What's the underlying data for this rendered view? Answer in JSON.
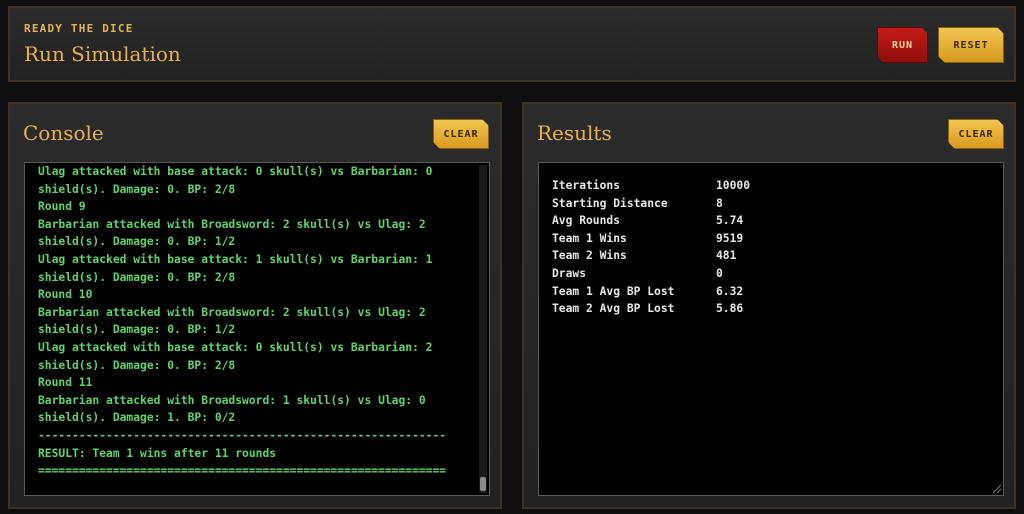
{
  "header": {
    "eyebrow": "READY THE DICE",
    "title": "Run Simulation",
    "run_label": "RUN",
    "reset_label": "RESET"
  },
  "console": {
    "title": "Console",
    "clear_label": "CLEAR",
    "lines": [
      "Ulag attacked with base attack: 0 skull(s) vs Barbarian: 0",
      "shield(s). Damage: 0. BP: 2/8",
      "Round 9",
      "Barbarian attacked with Broadsword: 2 skull(s) vs Ulag: 2",
      "shield(s). Damage: 0. BP: 1/2",
      "Ulag attacked with base attack: 1 skull(s) vs Barbarian: 1",
      "shield(s). Damage: 0. BP: 2/8",
      "Round 10",
      "Barbarian attacked with Broadsword: 2 skull(s) vs Ulag: 2",
      "shield(s). Damage: 0. BP: 1/2",
      "Ulag attacked with base attack: 0 skull(s) vs Barbarian: 2",
      "shield(s). Damage: 0. BP: 2/8",
      "Round 11",
      "Barbarian attacked with Broadsword: 1 skull(s) vs Ulag: 0",
      "shield(s). Damage: 1. BP: 0/2",
      "------------------------------------------------------------",
      "RESULT: Team 1 wins after 11 rounds",
      "============================================================"
    ]
  },
  "results": {
    "title": "Results",
    "clear_label": "CLEAR",
    "rows": [
      {
        "label": "Iterations",
        "value": "10000"
      },
      {
        "label": "Starting Distance",
        "value": "8"
      },
      {
        "label": "Avg Rounds",
        "value": "5.74"
      },
      {
        "label": "Team 1 Wins",
        "value": "9519"
      },
      {
        "label": "Team 2 Wins",
        "value": "481"
      },
      {
        "label": "Draws",
        "value": "0"
      },
      {
        "label": "Team 1 Avg BP Lost",
        "value": "6.32"
      },
      {
        "label": "Team 2 Avg BP Lost",
        "value": "5.86"
      }
    ]
  },
  "colors": {
    "accent_gold": "#e9b04c",
    "console_green": "#62d36b",
    "run_red": "#c41c18"
  }
}
